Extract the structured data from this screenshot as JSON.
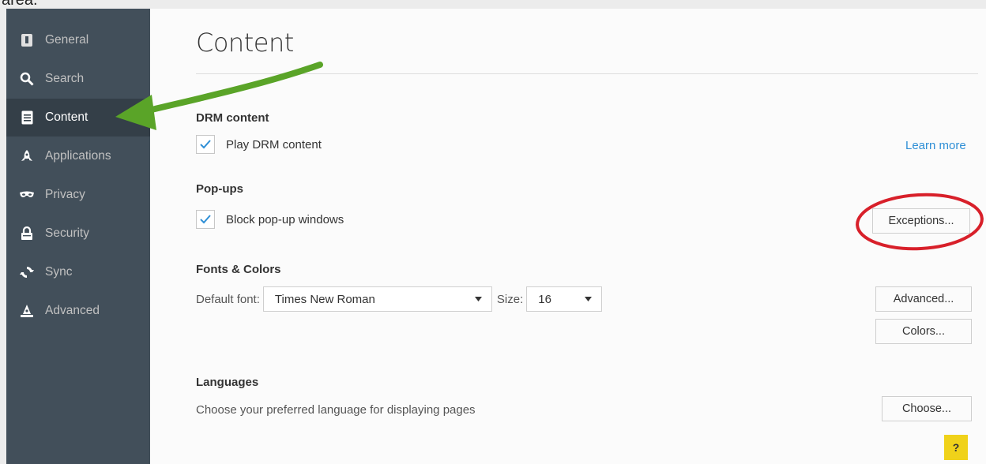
{
  "caption": {
    "text": "area."
  },
  "sidebar": {
    "items": [
      {
        "label": "General",
        "icon": "general-icon"
      },
      {
        "label": "Search",
        "icon": "search-icon"
      },
      {
        "label": "Content",
        "icon": "content-icon",
        "selected": true
      },
      {
        "label": "Applications",
        "icon": "applications-icon"
      },
      {
        "label": "Privacy",
        "icon": "privacy-mask-icon"
      },
      {
        "label": "Security",
        "icon": "lock-icon"
      },
      {
        "label": "Sync",
        "icon": "sync-icon"
      },
      {
        "label": "Advanced",
        "icon": "advanced-wizard-icon"
      }
    ]
  },
  "main": {
    "title": "Content",
    "drm": {
      "heading": "DRM content",
      "checkbox_label": "Play DRM content",
      "checked": true,
      "learn_more": "Learn more"
    },
    "popups": {
      "heading": "Pop-ups",
      "checkbox_label": "Block pop-up windows",
      "checked": true,
      "exceptions_button": "Exceptions..."
    },
    "fonts": {
      "heading": "Fonts & Colors",
      "default_font_label": "Default font:",
      "default_font_value": "Times New Roman",
      "size_label": "Size:",
      "size_value": "16",
      "advanced_button": "Advanced...",
      "colors_button": "Colors..."
    },
    "languages": {
      "heading": "Languages",
      "description": "Choose your preferred language for displaying pages",
      "choose_button": "Choose..."
    },
    "help_button": "?"
  },
  "colors": {
    "sidebar_bg": "#424f5a",
    "sidebar_selected_bg": "#343f48",
    "link": "#2f8fd6",
    "checkmark": "#2f8fd6",
    "annotation_arrow": "#5aa428",
    "annotation_circle": "#d8202a",
    "help_button": "#f0d21a"
  }
}
